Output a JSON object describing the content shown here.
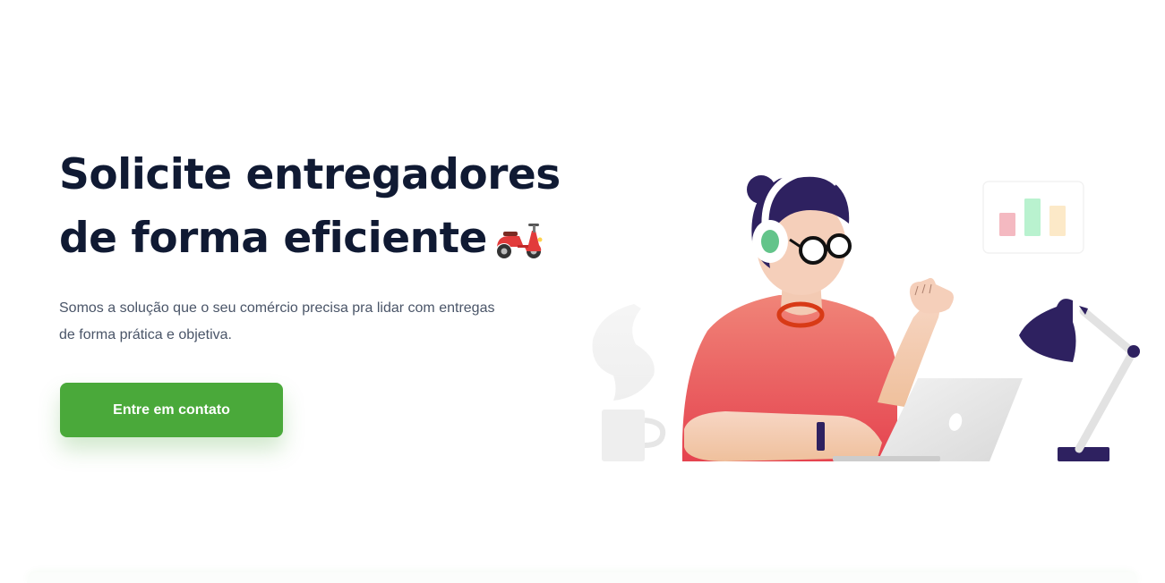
{
  "hero": {
    "title_line1": "Solicite entregadores",
    "title_line2": "de forma eficiente",
    "title_emoji": "scooter-icon",
    "subtitle_line1": "Somos a solução que o seu comércio precisa pra lidar com entregas",
    "subtitle_line2": "de forma prática e objetiva.",
    "cta_label": "Entre em contato"
  },
  "colors": {
    "title": "#101a33",
    "text": "#4a5568",
    "accent_green": "#4aa93a",
    "shirt_coral": "#e9525c",
    "hair_navy": "#2e2160"
  }
}
